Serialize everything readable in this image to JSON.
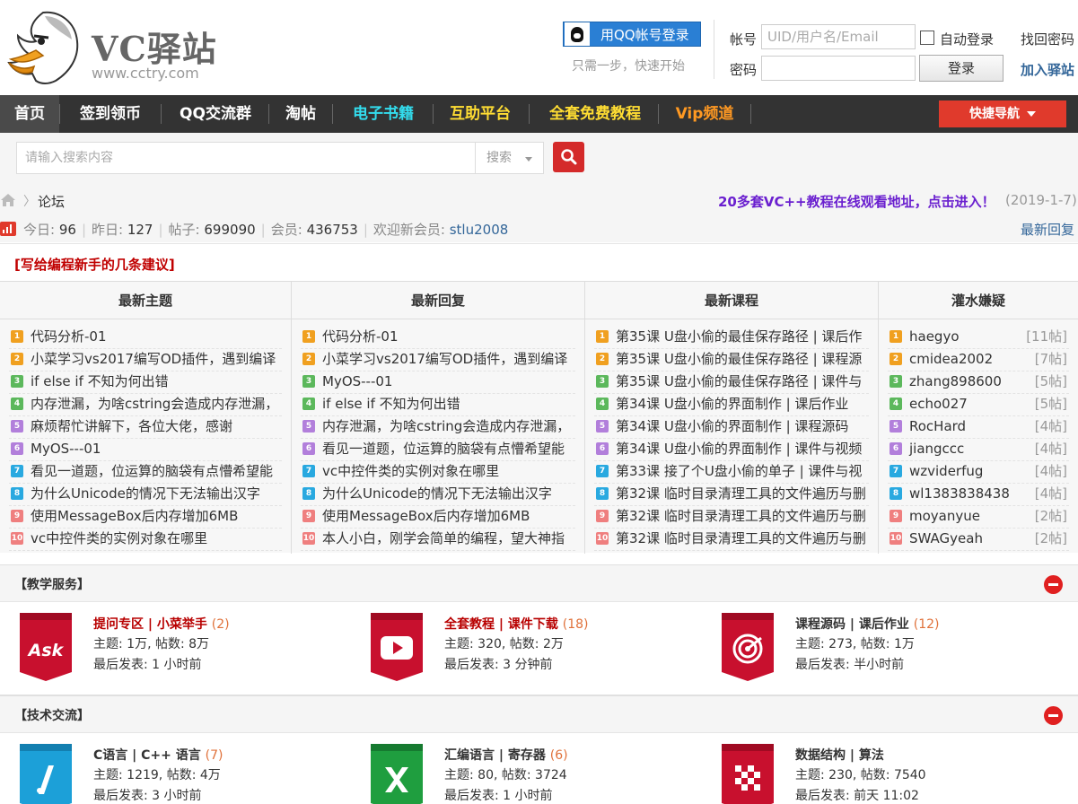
{
  "header": {
    "logo_title": "VC驿站",
    "logo_url": "www.cctry.com",
    "qq_login_label": "用QQ帐号登录",
    "qq_hint": "只需一步，快速开始",
    "account_label": "帐号",
    "account_placeholder": "UID/用户名/Email",
    "password_label": "密码",
    "auto_login_label": "自动登录",
    "login_button": "登录",
    "forgot_password": "找回密码",
    "join": "加入驿站"
  },
  "nav": {
    "items": [
      {
        "label": "首页",
        "color": "#ffffff"
      },
      {
        "label": "签到领币",
        "color": "#ffffff"
      },
      {
        "label": "QQ交流群",
        "color": "#ffffff"
      },
      {
        "label": "淘帖",
        "color": "#ffffff"
      },
      {
        "label": "电子书籍",
        "color": "#33ddee"
      },
      {
        "label": "互助平台",
        "color": "#ffdd33"
      },
      {
        "label": "全套免费教程",
        "color": "#ffdd33"
      },
      {
        "label": "Vip频道",
        "color": "#ff9922"
      }
    ],
    "quick_nav": "快捷导航"
  },
  "search": {
    "placeholder": "请输入搜索内容",
    "type_label": "搜索"
  },
  "breadcrumb": {
    "current": "论坛",
    "notice": "20多套VC++教程在线观看地址，点击进入！",
    "notice_date": "(2019-1-7)"
  },
  "stats": {
    "today_label": "今日:",
    "today": "96",
    "yesterday_label": "昨日:",
    "yesterday": "127",
    "posts_label": "帖子:",
    "posts": "699090",
    "members_label": "会员:",
    "members": "436753",
    "welcome_label": "欢迎新会员:",
    "welcome_user": "stlu2008",
    "latest_reply": "最新回复"
  },
  "colors": {
    "rank": [
      "#f0a020",
      "#f0a020",
      "#5cb85c",
      "#5cb85c",
      "#b27fdb",
      "#b27fdb",
      "#29a9e0",
      "#29a9e0",
      "#ef7f7f",
      "#ef7f7f"
    ]
  },
  "hot": {
    "title": "[写给编程新手的几条建议]",
    "columns": [
      {
        "head": "最新主题",
        "rows": [
          {
            "t": "代码分析-01"
          },
          {
            "t": "小菜学习vs2017编写OD插件，遇到编译"
          },
          {
            "t": "if else if 不知为何出错"
          },
          {
            "t": "内存泄漏，为啥cstring会造成内存泄漏，"
          },
          {
            "t": "麻烦帮忙讲解下，各位大佬，感谢"
          },
          {
            "t": "MyOS---01"
          },
          {
            "t": "看见一道题，位运算的脑袋有点懵希望能"
          },
          {
            "t": "为什么Unicode的情况下无法输出汉字"
          },
          {
            "t": "使用MessageBox后内存增加6MB"
          },
          {
            "t": "vc中控件类的实例对象在哪里"
          }
        ]
      },
      {
        "head": "最新回复",
        "rows": [
          {
            "t": "代码分析-01"
          },
          {
            "t": "小菜学习vs2017编写OD插件，遇到编译"
          },
          {
            "t": "MyOS---01"
          },
          {
            "t": "if else if 不知为何出错"
          },
          {
            "t": "内存泄漏，为啥cstring会造成内存泄漏，"
          },
          {
            "t": "看见一道题，位运算的脑袋有点懵希望能"
          },
          {
            "t": "vc中控件类的实例对象在哪里"
          },
          {
            "t": "为什么Unicode的情况下无法输出汉字"
          },
          {
            "t": "使用MessageBox后内存增加6MB"
          },
          {
            "t": "本人小白，刚学会简单的编程，望大神指"
          }
        ]
      },
      {
        "head": "最新课程",
        "rows": [
          {
            "t": "第35课 U盘小偷的最佳保存路径 | 课后作"
          },
          {
            "t": "第35课 U盘小偷的最佳保存路径 | 课程源"
          },
          {
            "t": "第35课 U盘小偷的最佳保存路径 | 课件与"
          },
          {
            "t": "第34课 U盘小偷的界面制作 | 课后作业"
          },
          {
            "t": "第34课 U盘小偷的界面制作 | 课程源码"
          },
          {
            "t": "第34课 U盘小偷的界面制作 | 课件与视频"
          },
          {
            "t": "第33课 接了个U盘小偷的单子 | 课件与视"
          },
          {
            "t": "第32课 临时目录清理工具的文件遍历与删"
          },
          {
            "t": "第32课 临时目录清理工具的文件遍历与删"
          },
          {
            "t": "第32课 临时目录清理工具的文件遍历与删"
          }
        ]
      },
      {
        "head": "灌水嫌疑",
        "rows": [
          {
            "t": "haegyo",
            "c": "[11帖]"
          },
          {
            "t": "cmidea2002",
            "c": "[7帖]"
          },
          {
            "t": "zhang898600",
            "c": "[5帖]"
          },
          {
            "t": "echo027",
            "c": "[5帖]"
          },
          {
            "t": "RocHard",
            "c": "[4帖]"
          },
          {
            "t": "jiangccc",
            "c": "[4帖]"
          },
          {
            "t": "wzviderfug",
            "c": "[4帖]"
          },
          {
            "t": "wl1383838438",
            "c": "[4帖]"
          },
          {
            "t": "moyanyue",
            "c": "[2帖]"
          },
          {
            "t": "SWAGyeah",
            "c": "[2帖]"
          }
        ]
      }
    ]
  },
  "sections": [
    {
      "title": "【教学服务】",
      "forums": [
        {
          "name": "提问专区 | 小菜举手",
          "count": "(2)",
          "stats": "主题: 1万, 帖数: 8万",
          "last": "最后发表: 1 小时前",
          "icon": "ask-icon",
          "red": true
        },
        {
          "name": "全套教程 | 课件下载",
          "count": "(18)",
          "stats": "主题: 320, 帖数: 2万",
          "last": "最后发表: 3 分钟前",
          "icon": "video-play-icon",
          "red": true
        },
        {
          "name": "课程源码 | 课后作业",
          "count": "(12)",
          "stats": "主题: 273, 帖数: 1万",
          "last": "最后发表: 半小时前",
          "icon": "target-icon",
          "red": false
        }
      ]
    },
    {
      "title": "【技术交流】",
      "forums": [
        {
          "name": "C语言 | C++ 语言",
          "count": "(7)",
          "stats": "主题: 1219, 帖数: 4万",
          "last": "最后发表: 3 小时前",
          "icon": "slash-icon",
          "red": false
        },
        {
          "name": "汇编语言 | 寄存器",
          "count": "(6)",
          "stats": "主题: 80, 帖数: 3724",
          "last": "最后发表: 1 小时前",
          "icon": "x-logo-icon",
          "red": false
        },
        {
          "name": "数据结构 | 算法",
          "count": "",
          "stats": "主题: 230, 帖数: 7540",
          "last": "最后发表: 前天 11:02",
          "icon": "checker-icon",
          "red": false
        }
      ]
    }
  ]
}
